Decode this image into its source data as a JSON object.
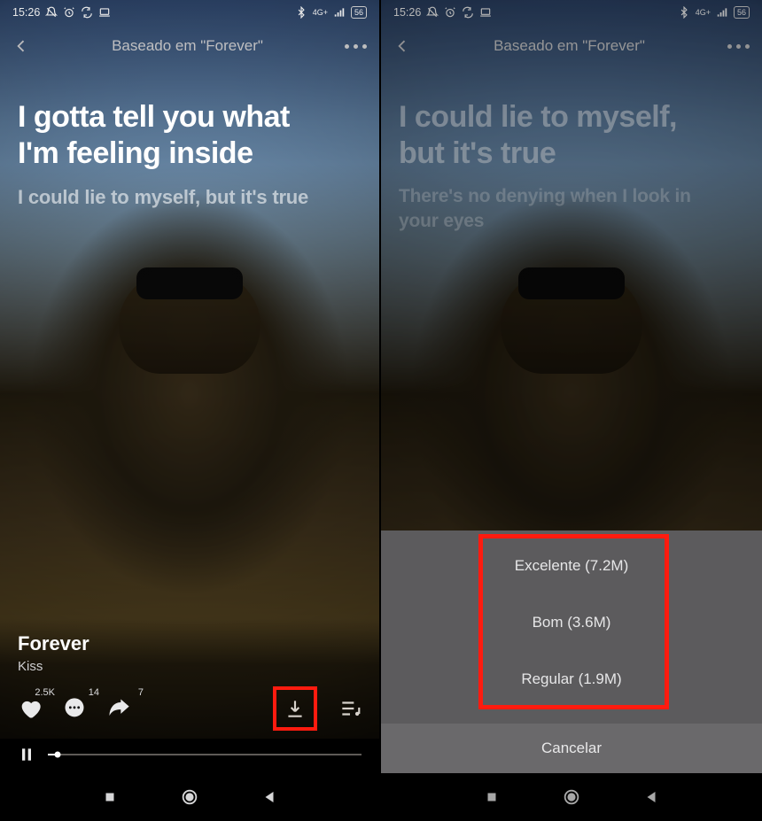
{
  "status": {
    "time": "15:26",
    "network_label": "4G+",
    "battery_level": "56"
  },
  "nav": {
    "title": "Baseado em \"Forever\""
  },
  "left": {
    "lyric_main": "I gotta tell you what I'm feeling inside",
    "lyric_next": "I could lie to myself, but it's true"
  },
  "right": {
    "lyric_main": "I could lie to myself, but it's true",
    "lyric_next": "There's no denying when I look in your eyes"
  },
  "song": {
    "title": "Forever",
    "artist": "Kiss"
  },
  "actions": {
    "like_count": "2.5K",
    "comment_count": "14",
    "share_count": "7"
  },
  "sheet": {
    "options": [
      {
        "label": "Excelente (7.2M)"
      },
      {
        "label": "Bom (3.6M)"
      },
      {
        "label": "Regular (1.9M)"
      }
    ],
    "cancel_label": "Cancelar"
  }
}
